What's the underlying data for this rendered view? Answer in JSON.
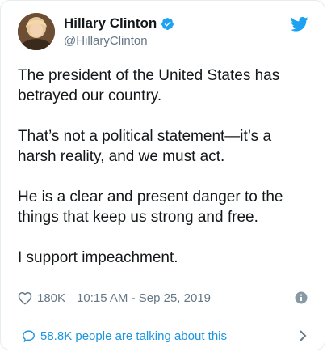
{
  "author": {
    "name": "Hillary Clinton",
    "handle": "@HillaryClinton",
    "verified_icon": "verified-badge-icon",
    "platform_icon": "twitter-bird-icon"
  },
  "tweet": {
    "paragraphs": [
      "The president of the United States has betrayed our country.",
      "That’s not a political statement—it’s a harsh reality, and we must act.",
      "He is a clear and present danger to the things that keep us strong and free.",
      "I support impeachment."
    ]
  },
  "meta": {
    "likes": "180K",
    "timestamp": "10:15 AM - Sep 25, 2019",
    "like_icon": "heart-icon",
    "info_icon": "info-icon"
  },
  "footer": {
    "text": "58.8K people are talking about this",
    "icon": "comment-bubble-icon",
    "chevron": "chevron-right-icon"
  },
  "colors": {
    "accent": "#1da1f2",
    "link": "#1b95e0",
    "muted": "#657786",
    "text": "#14171a"
  }
}
